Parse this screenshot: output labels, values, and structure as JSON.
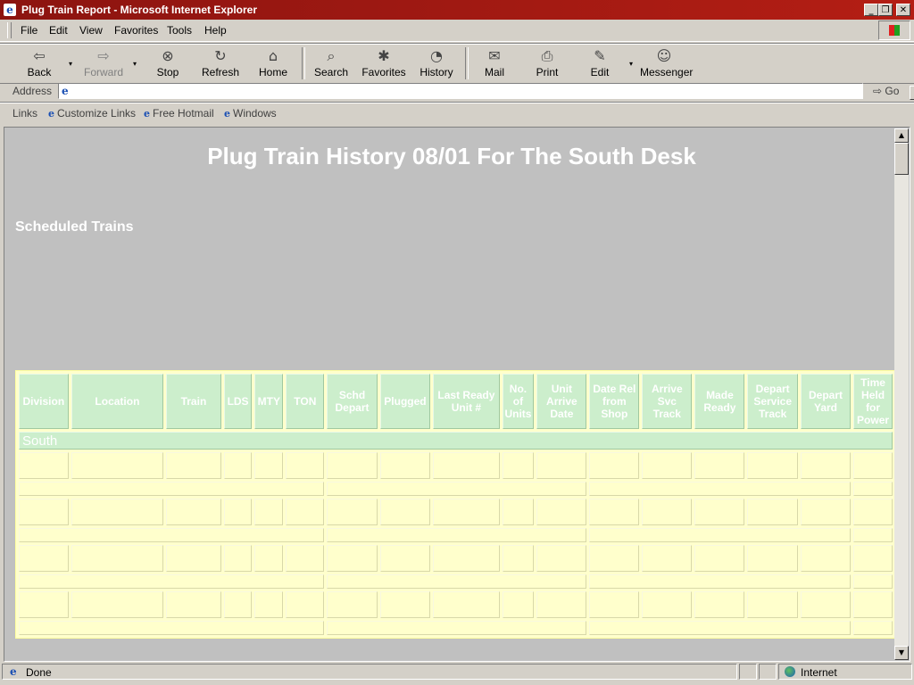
{
  "window": {
    "title": "Plug Train Report - Microsoft Internet Explorer"
  },
  "menu": [
    "File",
    "Edit",
    "View",
    "Favorites",
    "Tools",
    "Help"
  ],
  "toolbar": {
    "back": "Back",
    "forward": "Forward",
    "stop": "Stop",
    "refresh": "Refresh",
    "home": "Home",
    "search": "Search",
    "favorites": "Favorites",
    "history": "History",
    "mail": "Mail",
    "print": "Print",
    "edit": "Edit",
    "messenger": "Messenger"
  },
  "address": {
    "label": "Address",
    "value": "",
    "go": "Go"
  },
  "links": {
    "label": "Links",
    "items": [
      "Customize Links",
      "Free Hotmail",
      "Windows"
    ]
  },
  "page": {
    "title": "Plug Train History 08/01 For The South Desk",
    "section": "Scheduled Trains"
  },
  "table": {
    "headers": [
      "Division",
      "Location",
      "Train",
      "LDS",
      "MTY",
      "TON",
      "Schd Depart",
      "Plugged",
      "Last Ready Unit #",
      "No. of Units",
      "Unit Arrive Date",
      "Date Rel from Shop",
      "Arrive Svc Track",
      "Made Ready",
      "Depart Service Track",
      "Depart Yard",
      "Time Held for Power"
    ],
    "division": "South"
  },
  "status": {
    "text": "Done",
    "zone": "Internet"
  }
}
